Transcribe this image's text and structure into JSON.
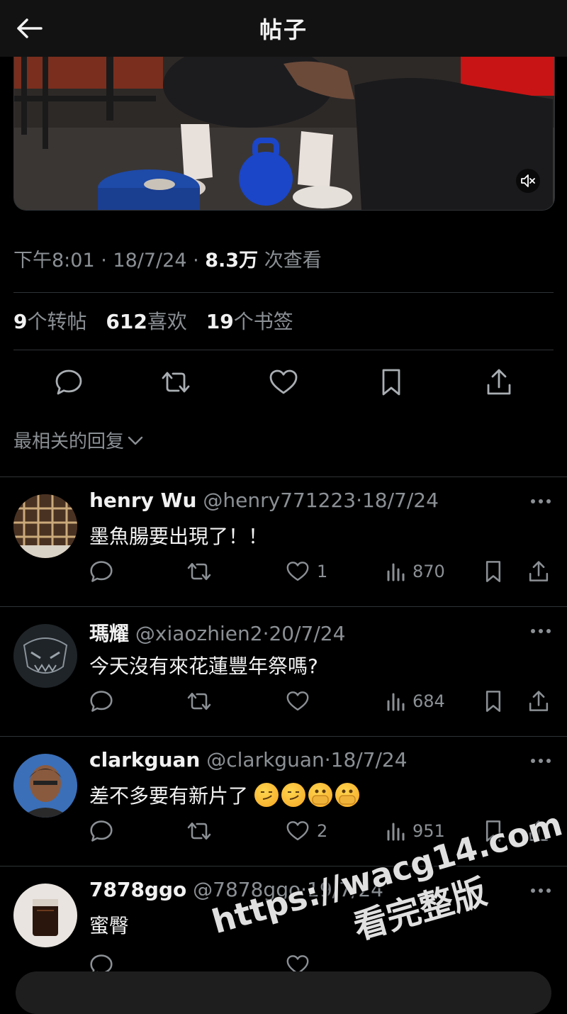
{
  "header": {
    "title": "帖子"
  },
  "post": {
    "time": "下午8:01",
    "date": "18/7/24",
    "views_value": "8.3万",
    "views_label": "次查看",
    "reposts_value": "9",
    "reposts_label": "个转帖",
    "likes_value": "612",
    "likes_label": "喜欢",
    "bookmarks_value": "19",
    "bookmarks_label": "个书签"
  },
  "sort": {
    "label": "最相关的回复"
  },
  "replies": [
    {
      "name": "henry Wu",
      "handle": "@henry771223",
      "date": "18/7/24",
      "text": "墨魚腸要出現了！！",
      "likes": "1",
      "views": "870"
    },
    {
      "name": "瑪耀",
      "handle": "@xiaozhien2",
      "date": "20/7/24",
      "text": "今天沒有來花蓮豐年祭嗎?",
      "likes": "",
      "views": "684"
    },
    {
      "name": "clarkguan",
      "handle": "@clarkguan",
      "date": "18/7/24",
      "text": "差不多要有新片了",
      "likes": "2",
      "views": "951"
    },
    {
      "name": "7878ggo",
      "handle": "@7878ggo",
      "date": "19/7/24",
      "text": "蜜臀",
      "likes": "",
      "views": ""
    }
  ],
  "watermark": {
    "line1": "https://wacg14.com",
    "line2": "看完整版"
  },
  "icons": {
    "back": "arrow-left-icon",
    "mute": "speaker-muted-icon",
    "reply": "speech-bubble-icon",
    "repost": "repost-icon",
    "like": "heart-icon",
    "bookmark": "bookmark-icon",
    "share": "share-icon",
    "views": "bar-chart-icon",
    "more": "ellipsis-icon",
    "chevron": "chevron-down-icon"
  },
  "colors": {
    "background": "#000000",
    "text": "#e7e9ea",
    "muted": "#8b9095",
    "divider": "#2f3336"
  }
}
